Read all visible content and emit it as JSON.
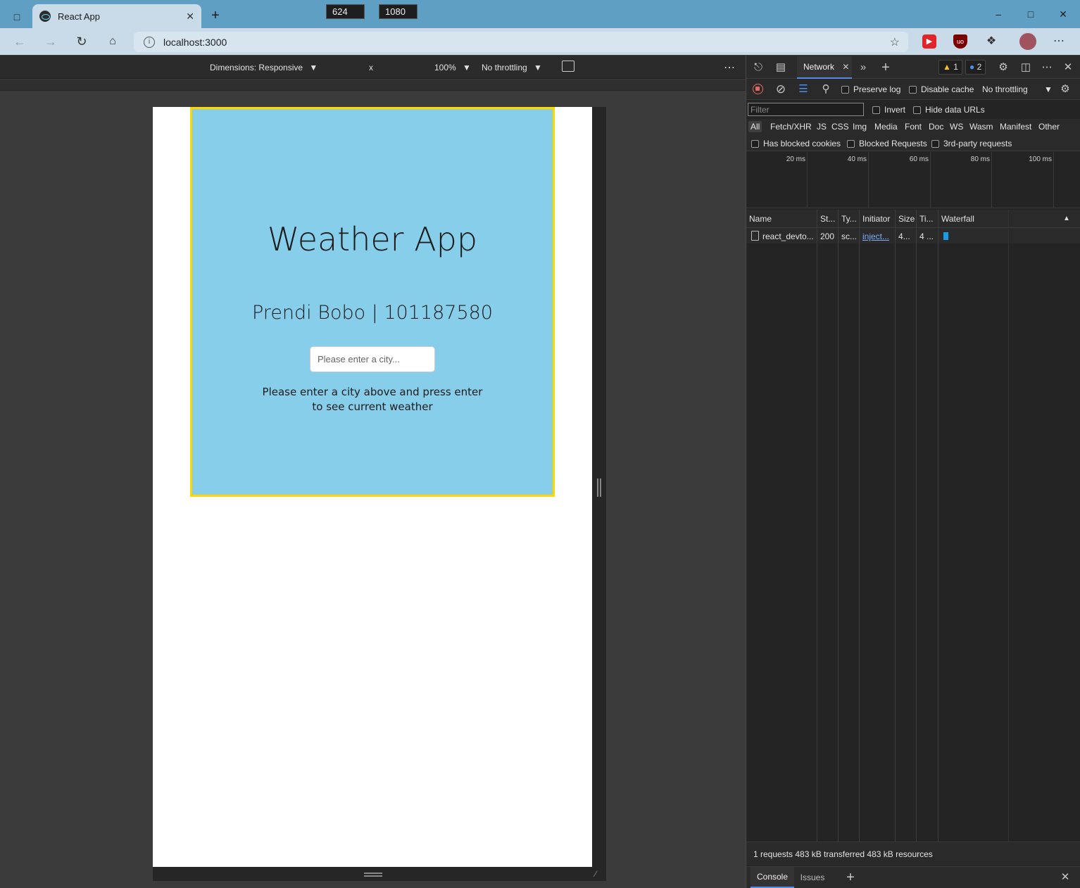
{
  "browser": {
    "tab_title": "React App",
    "url": "localhost:3000",
    "icons": {
      "sidebar": "tab-actions-icon",
      "close_tab": "close-icon",
      "new_tab": "plus-icon",
      "minimize": "minimize-icon",
      "maximize": "maximize-icon",
      "close_window": "close-icon",
      "back": "back-arrow-icon",
      "forward": "forward-arrow-icon",
      "refresh": "refresh-icon",
      "home": "home-icon",
      "site_info": "info-icon",
      "favorite": "star-plus-icon",
      "extensions": "puzzle-icon",
      "more": "ellipsis-icon"
    }
  },
  "device_toolbar": {
    "dimensions_label": "Dimensions: Responsive",
    "width": "624",
    "times": "x",
    "height": "1080",
    "zoom": "100%",
    "throttling": "No throttling",
    "more": "⋯"
  },
  "page": {
    "title": "Weather App",
    "subtitle": "Prendi Bobo | 101187580",
    "city_placeholder": "Please enter a city...",
    "instructions": "Please enter a city above and press enter to see current weather",
    "card_background": "#87ceeb",
    "card_border": "#ffd700"
  },
  "devtools": {
    "active_tab": "Network",
    "warnings_count": "1",
    "messages_count": "2",
    "toolbar": {
      "preserve_log": "Preserve log",
      "disable_cache": "Disable cache",
      "throttling": "No throttling"
    },
    "filter_placeholder": "Filter",
    "invert": "Invert",
    "hide_data_urls": "Hide data URLs",
    "types": [
      "All",
      "Fetch/XHR",
      "JS",
      "CSS",
      "Img",
      "Media",
      "Font",
      "Doc",
      "WS",
      "Wasm",
      "Manifest",
      "Other"
    ],
    "has_blocked_cookies": "Has blocked cookies",
    "blocked_requests": "Blocked Requests",
    "third_party": "3rd-party requests",
    "timeline_labels": [
      "20 ms",
      "40 ms",
      "60 ms",
      "80 ms",
      "100 ms"
    ],
    "columns": [
      "Name",
      "St...",
      "Ty...",
      "Initiator",
      "Size",
      "Ti...",
      "Waterfall"
    ],
    "rows": [
      {
        "name": "react_devto...",
        "status": "200",
        "type": "sc...",
        "initiator": "inject...",
        "size": "4...",
        "time": "4 ..."
      }
    ],
    "summary": "1 requests  483 kB transferred  483 kB resources",
    "drawer_tabs": [
      "Console",
      "Issues"
    ],
    "accent": "#4c8ff4"
  }
}
